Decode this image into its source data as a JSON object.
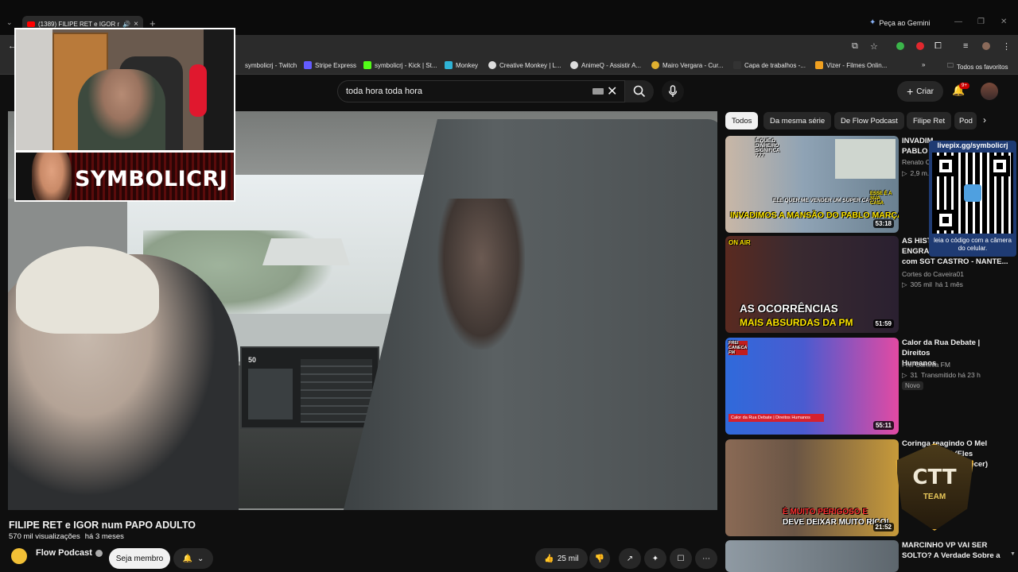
{
  "browser": {
    "tab_title": "(1389) FILIPE RET e IGOR num PAPO ADULTO - YouTube",
    "gemini_label": "Peça ao Gemini",
    "bookmarks": [
      {
        "label": "symbolicrj - Twitch",
        "color": "#9146ff"
      },
      {
        "label": "Stripe Express",
        "color": "#635bff"
      },
      {
        "label": "symbolicrj - Kick | St...",
        "color": "#53fc18"
      },
      {
        "label": "Monkey",
        "color": "#2fb3d6"
      },
      {
        "label": "Creative Monkey | L...",
        "color": "#dddddd"
      },
      {
        "label": "AnimeQ - Assistir A...",
        "color": "#dddddd"
      },
      {
        "label": "Mairo Vergara - Cur...",
        "color": "#e0b030"
      },
      {
        "label": "Capa de trabalhos -...",
        "color": "#333333"
      },
      {
        "label": "Vizer - Filmes Onlin...",
        "color": "#f0a020"
      }
    ],
    "all_bookmarks": "Todos os favoritos",
    "more_bookmarks": "»"
  },
  "youtube": {
    "search_value": "toda hora toda hora",
    "create_label": "Criar",
    "notifications_badge": "9+",
    "accent": "#ff0000"
  },
  "overlay": {
    "streamer_name": "SYMBOLICRJ",
    "qr_url": "livepix.gg/symbolicrj",
    "qr_hint": "leia o código com a câmera do celular.",
    "ctt_word": "CTT",
    "ctt_sub": "TEAM"
  },
  "video": {
    "speed_readout": "50",
    "title": "FILIPE RET e IGOR num PAPO ADULTO",
    "views": "570 mil visualizações",
    "age": "há 3 meses",
    "channel": "Flow Podcast",
    "member_label": "Seja membro",
    "likes": "25 mil"
  },
  "chips": [
    "Todos",
    "Da mesma série",
    "De Flow Podcast",
    "Filipe Ret",
    "Pod"
  ],
  "recommendations": [
    {
      "title_line1": "INVADIM...",
      "title_line2": "PABLO ...",
      "channel": "Renato C...",
      "stats": "2,9 m...",
      "duration": "53:18",
      "caption": "INVADIMOS A MANSÃO DO PABLO MARÇAL",
      "top_caption_1": "É QUE O DINHEIRO SIGNIFICA ???",
      "top_caption_2": "ELE QUER ME VENDER UM SUPER CARRO",
      "side_caption": "ESSE É A SUA CASA"
    },
    {
      "title_line1": "AS HIST...",
      "title_line2": "ENGRA...",
      "title_line3": "com SGT CASTRO - NANTE...",
      "channel": "Cortes do Caveira01",
      "views": "305 mil",
      "age": "há 1 mês",
      "duration": "51:59",
      "onair": "ON AIR",
      "caption_1": "AS OCORRÊNCIAS",
      "caption_2": "MAIS ABSURDAS DA PM"
    },
    {
      "title_line1": "Calor da Rua Debate | Direitos",
      "title_line2": "Humanos",
      "channel": "Frei Caneca FM",
      "views": "31",
      "age": "Transmitido há 23 h",
      "badge": "Novo",
      "duration": "55:11",
      "logo": "FREI CANECA FM",
      "lower_third": "Calor da Rua Debate | Direitos Humanos"
    },
    {
      "title_line1": "Coringa reagindo O Mel",
      "title_line2": "...Nepal (Eles",
      "title_line3": "...uquecer)",
      "duration": "21:52",
      "caption_1": "É MUITO PERIGOSO E",
      "caption_2": "DEVE DEIXAR MUITO RICO!"
    },
    {
      "title_line1": "MARCINHO VP VAI SER",
      "title_line2": "SOLTO? A Verdade Sobre a"
    }
  ]
}
